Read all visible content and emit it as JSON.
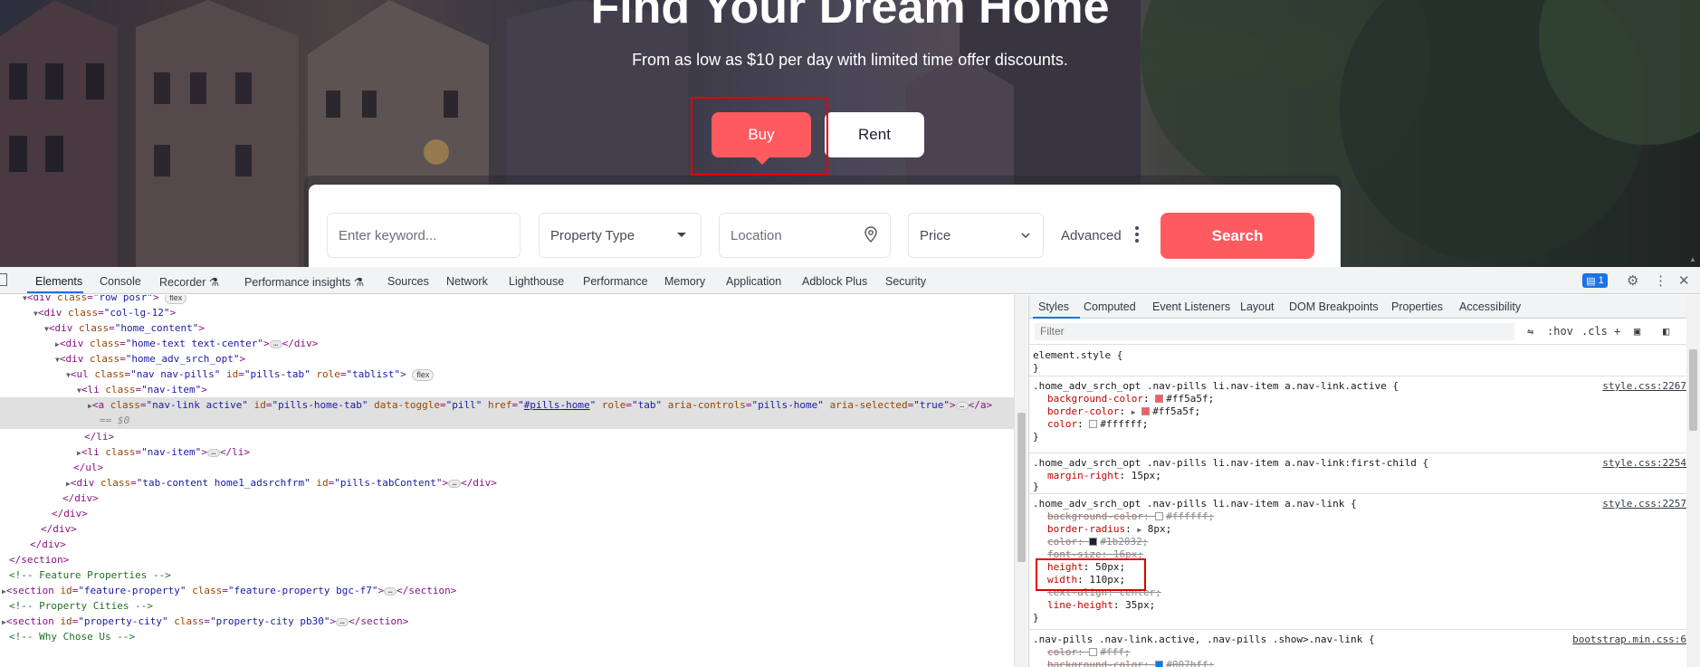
{
  "hero": {
    "title": "Find Your Dream Home",
    "subtitle": "From as low as $10 per day with limited time offer discounts.",
    "tabs": [
      {
        "label": "Buy",
        "active": true
      },
      {
        "label": "Rent",
        "active": false
      }
    ],
    "accent_color": "#ff5a5f"
  },
  "search": {
    "keyword_placeholder": "Enter keyword...",
    "property_type": "Property Type",
    "location_placeholder": "Location",
    "price": "Price",
    "advanced_label": "Advanced",
    "search_button": "Search"
  },
  "devtools": {
    "tabs": [
      "Elements",
      "Console",
      "Recorder",
      "Performance insights",
      "Sources",
      "Network",
      "Lighthouse",
      "Performance",
      "Memory",
      "Application",
      "Adblock Plus",
      "Security"
    ],
    "active_tab": "Elements",
    "issues_count": "1",
    "dom_lines": [
      {
        "text": "<div class=\"row posr\">",
        "badge": "flex"
      },
      {
        "text": "<div class=\"col-lg-12\">"
      },
      {
        "text": "<div class=\"home_content\">"
      },
      {
        "text": "<div class=\"home-text text-center\">",
        "closing": "</div>"
      },
      {
        "text": "<div class=\"home_adv_srch_opt\">"
      },
      {
        "text": "<ul class=\"nav nav-pills\" id=\"pills-tab\" role=\"tablist\">",
        "badge": "flex"
      },
      {
        "text": "<li class=\"nav-item\">"
      },
      {
        "text": "<a class=\"nav-link active\" id=\"pills-home-tab\" data-toggle=\"pill\" href=\"#pills-home\" role=\"tab\" aria-controls=\"pills-home\" aria-selected=\"true\">",
        "closing": "</a>",
        "selected": true,
        "sub": "== $0"
      },
      {
        "text": "</li>"
      },
      {
        "text": "<li class=\"nav-item\">",
        "closing": "</li>"
      },
      {
        "text": "</ul>"
      },
      {
        "text": "<div class=\"tab-content home1_adsrchfrm\" id=\"pills-tabContent\">",
        "closing": "</div>"
      },
      {
        "text": "</div>"
      },
      {
        "text": "</div>"
      },
      {
        "text": "</div>"
      },
      {
        "text": "</div>"
      },
      {
        "text": "</section>"
      },
      {
        "text": "<!-- Feature Properties -->",
        "comment": true
      },
      {
        "text": "<section id=\"feature-property\" class=\"feature-property bgc-f7\">",
        "closing": "</section>"
      },
      {
        "text": "<!-- Property Cities -->",
        "comment": true
      },
      {
        "text": "<section id=\"property-city\" class=\"property-city pb30\">",
        "closing": "</section>"
      },
      {
        "text": "<!-- Why Chose Us -->",
        "comment": true
      }
    ],
    "styles_tabs": [
      "Styles",
      "Computed",
      "Event Listeners",
      "Layout",
      "DOM Breakpoints",
      "Properties",
      "Accessibility"
    ],
    "filter_placeholder": "Filter",
    "filter_tools": [
      ":hov",
      ".cls",
      "+"
    ],
    "rules": [
      {
        "selector": "element.style {",
        "source": "",
        "props": []
      },
      {
        "selector": ".home_adv_srch_opt .nav-pills li.nav-item a.nav-link.active {",
        "source": "style.css:2267",
        "props": [
          {
            "name": "background-color",
            "value": "#ff5a5f",
            "swatch": "#ff5a5f"
          },
          {
            "name": "border-color",
            "value": "#ff5a5f",
            "swatch": "#ff5a5f",
            "expand": true
          },
          {
            "name": "color",
            "value": "#ffffff",
            "swatch": "#ffffff"
          }
        ]
      },
      {
        "selector": ".home_adv_srch_opt .nav-pills li.nav-item a.nav-link:first-child {",
        "source": "style.css:2254",
        "props": [
          {
            "name": "margin-right",
            "value": "15px"
          }
        ]
      },
      {
        "selector": ".home_adv_srch_opt .nav-pills li.nav-item a.nav-link {",
        "source": "style.css:2257",
        "props": [
          {
            "name": "background-color",
            "value": "#ffffff",
            "swatch": "#ffffff",
            "struck": true
          },
          {
            "name": "border-radius",
            "value": "8px",
            "expand": true
          },
          {
            "name": "color",
            "value": "#1b2032",
            "swatch": "#1b2032",
            "struck": true
          },
          {
            "name": "font-size",
            "value": "16px",
            "struck": true
          },
          {
            "name": "height",
            "value": "50px"
          },
          {
            "name": "width",
            "value": "110px"
          },
          {
            "name": "text-align",
            "value": "center",
            "struck": true
          },
          {
            "name": "line-height",
            "value": "35px"
          }
        ]
      },
      {
        "selector": ".nav-pills .nav-link.active, .nav-pills .show>.nav-link {",
        "source": "bootstrap.min.css:6",
        "props": [
          {
            "name": "color",
            "value": "#fff",
            "swatch": "#ffffff",
            "struck": true
          },
          {
            "name": "background-color",
            "value": "#007bff",
            "swatch": "#007bff",
            "struck": true
          }
        ]
      }
    ]
  }
}
